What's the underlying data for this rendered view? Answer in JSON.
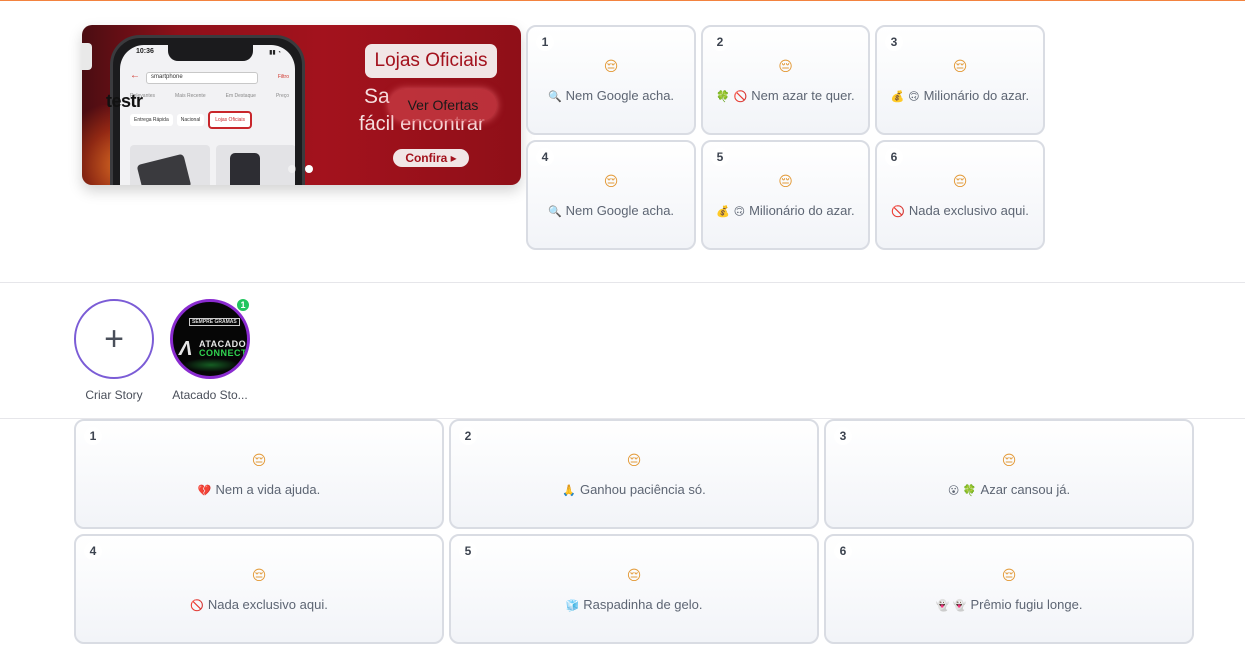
{
  "banner": {
    "phone_time": "10:36",
    "phone_search": "smartphone",
    "phone_filter": "Filtro",
    "phone_tabs": [
      "Relevantes",
      "Mais Recente",
      "Em Destaque",
      "Preço"
    ],
    "phone_chips": [
      "Entrega Rápida",
      "Nacional",
      "Lojas Oficiais"
    ],
    "overlay_text": "testr",
    "badge": "Lojas Oficiais",
    "headline_1": "Sa",
    "headline_2": "fácil encontrar",
    "cta_overlay": "Ver Ofertas",
    "cta": "Confira ▸",
    "slides": 2,
    "active_slide": 2
  },
  "top_grid": [
    {
      "num": "1",
      "emoji": "😔",
      "icons": "🔍",
      "text": "Nem Google acha."
    },
    {
      "num": "2",
      "emoji": "😔",
      "icons": "🍀 🚫",
      "text": "Nem azar te quer."
    },
    {
      "num": "3",
      "emoji": "😔",
      "icons": "💰 🙃",
      "text": "Milionário do azar."
    },
    {
      "num": "4",
      "emoji": "😔",
      "icons": "🔍",
      "text": "Nem Google acha."
    },
    {
      "num": "5",
      "emoji": "😔",
      "icons": "💰 🙃",
      "text": "Milionário do azar."
    },
    {
      "num": "6",
      "emoji": "😔",
      "icons": "🚫",
      "text": "Nada exclusivo aqui."
    }
  ],
  "stories": {
    "create_label": "Criar Story",
    "store_label": "Atacado Sto...",
    "store_badge": "1",
    "avatar_top": "SEMPRE GRAMAS",
    "avatar_title": "ATACADO",
    "avatar_sub": "CONNECT"
  },
  "bottom_grid": [
    {
      "num": "1",
      "emoji": "😔",
      "icons": "💔",
      "text": "Nem a vida ajuda."
    },
    {
      "num": "2",
      "emoji": "😔",
      "icons": "🙏",
      "text": "Ganhou paciência só."
    },
    {
      "num": "3",
      "emoji": "😔",
      "icons": "😮 🍀",
      "text": "Azar cansou já."
    },
    {
      "num": "4",
      "emoji": "😔",
      "icons": "🚫",
      "text": "Nada exclusivo aqui."
    },
    {
      "num": "5",
      "emoji": "😔",
      "icons": "🧊",
      "text": "Raspadinha de gelo."
    },
    {
      "num": "6",
      "emoji": "😔",
      "icons": "👻 👻",
      "text": "Prêmio fugiu longe."
    }
  ],
  "colors": {
    "accent_line": "#f3833f",
    "banner_red": "#a3121d",
    "story_ring": "#7b5cd6",
    "badge_green": "#22c55e"
  }
}
